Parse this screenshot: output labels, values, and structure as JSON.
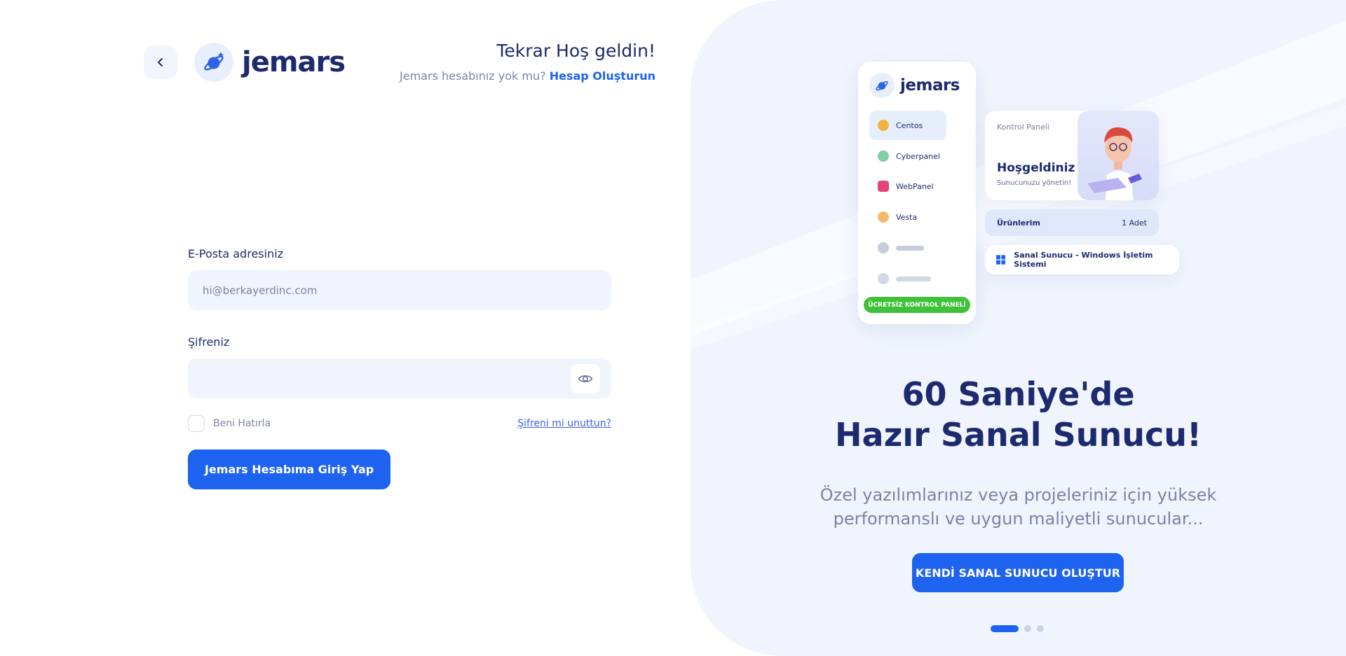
{
  "brand": {
    "name": "jemars"
  },
  "welcome": {
    "title": "Tekrar Hoş geldin!",
    "no_account": "Jemars hesabınız yok mu?",
    "create_account": "Hesap Oluşturun"
  },
  "form": {
    "email_label": "E-Posta adresiniz",
    "email_placeholder": "hi@berkayerdinc.com",
    "password_label": "Şifreniz",
    "remember_label": "Beni Hatırla",
    "forgot_label": "Şifreni mi unuttun?",
    "login_label": "Jemars Hesabıma Giriş Yap"
  },
  "mockup": {
    "brand_name": "jemars",
    "menu": [
      {
        "label": "Centos",
        "color": "#f0b43c"
      },
      {
        "label": "Cyberpanel",
        "color": "#7fcfa0"
      },
      {
        "label": "WebPanel",
        "color": "#e0457a"
      },
      {
        "label": "Vesta",
        "color": "#f4b96b"
      }
    ],
    "cta": "ÜCRETSİZ KONTROL PANELİ",
    "card_small": "Kontrol Paneli",
    "card_title": "Hoşgeldiniz",
    "card_sub": "Sunucunuzu yönetin!",
    "products_label": "Ürünlerim",
    "products_count": "1 Adet",
    "server_label": "Sanal Sunucu - Windows İşletim Sistemi"
  },
  "hero": {
    "title_line1": "60 Saniye'de",
    "title_line2": "Hazır Sanal Sunucu!",
    "sub_line1": "Özel yazılımlarınız veya projeleriniz için yüksek",
    "sub_line2": "performanslı ve uygun maliyetli sunucular...",
    "cta": "KENDİ SANAL SUNUCU OLUŞTUR"
  },
  "colors": {
    "primary": "#1e62f0",
    "navy": "#1d2a6e",
    "panel_bg": "#f0f5fd",
    "success": "#3ec23a"
  }
}
